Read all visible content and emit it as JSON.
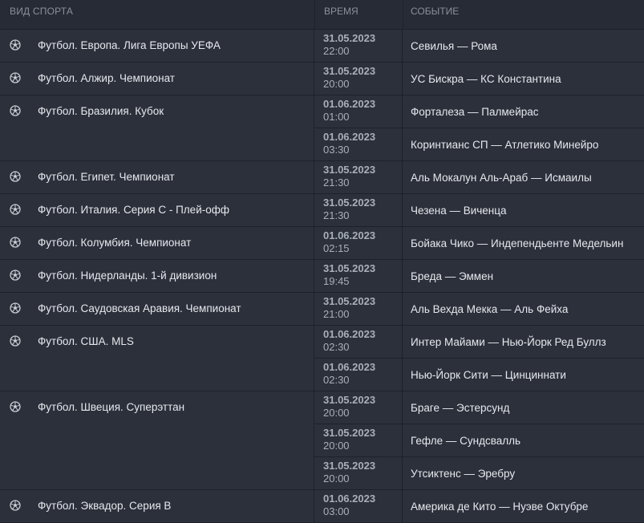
{
  "header": {
    "sport": "ВИД СПОРТА",
    "time": "ВРЕМЯ",
    "event": "СОБЫТИЕ"
  },
  "groups": [
    {
      "sport": "Футбол. Европа. Лига Европы УЕФА",
      "events": [
        {
          "date": "31.05.2023",
          "time": "22:00",
          "event": "Севилья — Рома"
        }
      ]
    },
    {
      "sport": "Футбол. Алжир. Чемпионат",
      "events": [
        {
          "date": "31.05.2023",
          "time": "20:00",
          "event": "УС Бискра — КС Константина"
        }
      ]
    },
    {
      "sport": "Футбол. Бразилия. Кубок",
      "events": [
        {
          "date": "01.06.2023",
          "time": "01:00",
          "event": "Форталеза — Палмейрас"
        },
        {
          "date": "01.06.2023",
          "time": "03:30",
          "event": "Коринтианс СП — Атлетико Минейро"
        }
      ]
    },
    {
      "sport": "Футбол. Египет. Чемпионат",
      "events": [
        {
          "date": "31.05.2023",
          "time": "21:30",
          "event": "Аль Мокалун Аль-Араб — Исмаилы"
        }
      ]
    },
    {
      "sport": "Футбол. Италия. Серия С - Плей-офф",
      "events": [
        {
          "date": "31.05.2023",
          "time": "21:30",
          "event": "Чезена — Виченца"
        }
      ]
    },
    {
      "sport": "Футбол. Колумбия. Чемпионат",
      "events": [
        {
          "date": "01.06.2023",
          "time": "02:15",
          "event": "Бойака Чико — Индепендьенте Медельин"
        }
      ]
    },
    {
      "sport": "Футбол. Нидерланды. 1-й дивизион",
      "events": [
        {
          "date": "31.05.2023",
          "time": "19:45",
          "event": "Бреда — Эммен"
        }
      ]
    },
    {
      "sport": "Футбол. Саудовская Аравия. Чемпионат",
      "events": [
        {
          "date": "31.05.2023",
          "time": "21:00",
          "event": "Аль Вехда Мекка — Аль Фейха"
        }
      ]
    },
    {
      "sport": "Футбол. США. MLS",
      "events": [
        {
          "date": "01.06.2023",
          "time": "02:30",
          "event": "Интер Майами — Нью-Йорк Ред Буллз"
        },
        {
          "date": "01.06.2023",
          "time": "02:30",
          "event": "Нью-Йорк Сити — Цинциннати"
        }
      ]
    },
    {
      "sport": "Футбол. Швеция. Суперэттан",
      "events": [
        {
          "date": "31.05.2023",
          "time": "20:00",
          "event": "Браге — Эстерсунд"
        },
        {
          "date": "31.05.2023",
          "time": "20:00",
          "event": "Гефле — Сундсвалль"
        },
        {
          "date": "31.05.2023",
          "time": "20:00",
          "event": "Утсиктенс — Эребру"
        }
      ]
    },
    {
      "sport": "Футбол. Эквадор. Серия B",
      "events": [
        {
          "date": "01.06.2023",
          "time": "03:00",
          "event": "Америка де Кито — Нуэве Октубре"
        }
      ]
    }
  ],
  "icons": {
    "sport": "soccer-ball-icon"
  },
  "colors": {
    "background": "#2b303b",
    "header": "#272b35",
    "divider": "#1d2129",
    "muted": "#a9afba"
  }
}
